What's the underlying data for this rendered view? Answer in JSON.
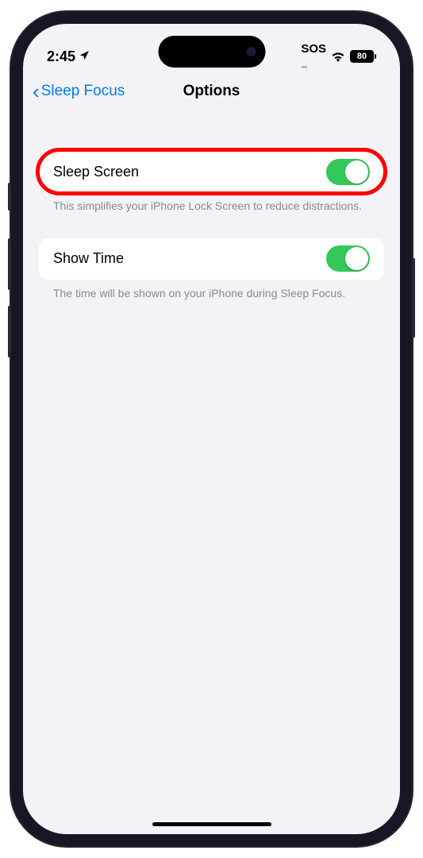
{
  "statusBar": {
    "time": "2:45",
    "sos": "SOS",
    "battery": "80"
  },
  "nav": {
    "backLabel": "Sleep Focus",
    "title": "Options"
  },
  "settings": {
    "sleepScreen": {
      "label": "Sleep Screen",
      "description": "This simplifies your iPhone Lock Screen to reduce distractions.",
      "enabled": true
    },
    "showTime": {
      "label": "Show Time",
      "description": "The time will be shown on your iPhone during Sleep Focus.",
      "enabled": true
    }
  }
}
